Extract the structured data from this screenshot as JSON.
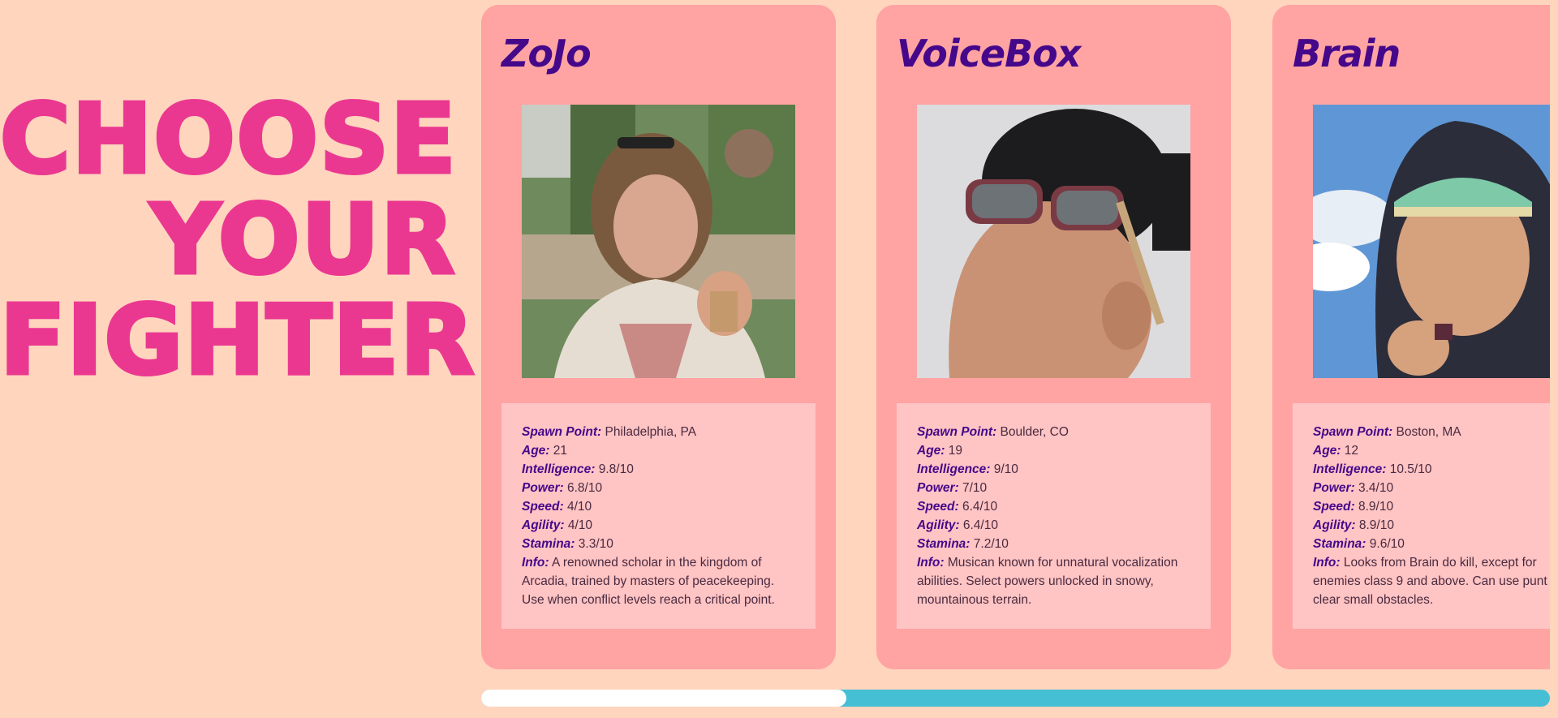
{
  "heading": {
    "line1": "CHOOSE",
    "line2": "YOUR",
    "line3": "FIGHTER"
  },
  "labels": {
    "spawn": "Spawn Point:",
    "age": "Age:",
    "intelligence": "Intelligence:",
    "power": "Power:",
    "speed": "Speed:",
    "agility": "Agility:",
    "stamina": "Stamina:",
    "info": "Info:"
  },
  "fighters": [
    {
      "name": "ZoJo",
      "spawn": "Philadelphia, PA",
      "age": "21",
      "intelligence": "9.8/10",
      "power": "6.8/10",
      "speed": "4/10",
      "agility": "4/10",
      "stamina": "3.3/10",
      "info": "A renowned scholar in the kingdom of Arcadia, trained by masters of peacekeeping. Use when conflict levels reach a critical point."
    },
    {
      "name": "VoiceBox",
      "spawn": "Boulder, CO",
      "age": "19",
      "intelligence": "9/10",
      "power": "7/10",
      "speed": "6.4/10",
      "agility": "6.4/10",
      "stamina": "7.2/10",
      "info": "Musican known for unnatural vocalization abilities. Select powers unlocked in snowy, mountainous terrain."
    },
    {
      "name": "Brain",
      "spawn": "Boston, MA",
      "age": "12",
      "intelligence": "10.5/10",
      "power": "3.4/10",
      "speed": "8.9/10",
      "agility": "8.9/10",
      "stamina": "9.6/10",
      "info": "Looks from Brain do kill, except for enemies class 9 and above. Can use punt to clear small obstacles."
    }
  ],
  "scroll": {
    "thumb_fraction": 0.342
  },
  "colors": {
    "background": "#ffd5bd",
    "title": "#ea3891",
    "card": "#ffa3a3",
    "info_box": "#ffc4c4",
    "accent_text": "#45088a",
    "scroll_track": "#45bfd4",
    "scroll_thumb": "#ffffff"
  }
}
